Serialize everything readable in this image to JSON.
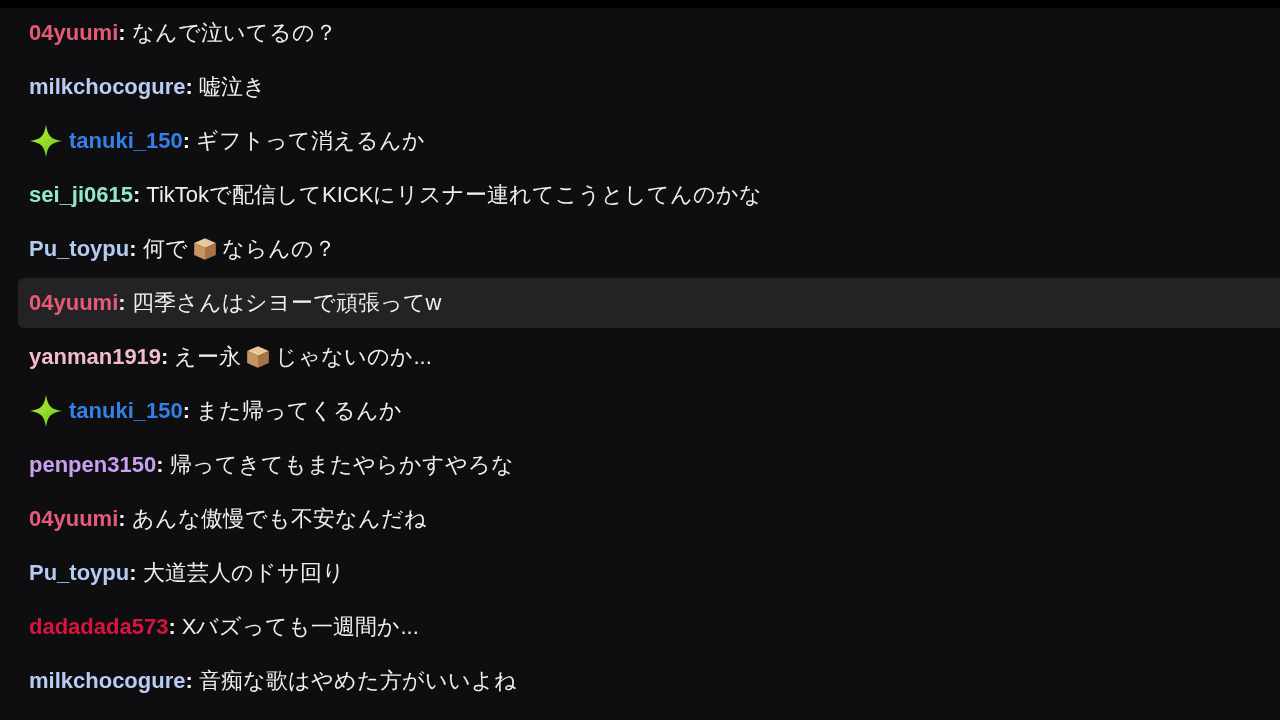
{
  "messages": [
    {
      "user": "04yuumi",
      "separator": ":",
      "color": "#e65a78",
      "badge": false,
      "selected": false,
      "parts": [
        {
          "kind": "text",
          "text": "なんで泣いてるの？"
        }
      ]
    },
    {
      "user": "milkchocogure",
      "separator": ":",
      "color": "#b8cdf2",
      "badge": false,
      "selected": false,
      "parts": [
        {
          "kind": "text",
          "text": "嘘泣き"
        }
      ]
    },
    {
      "user": "tanuki_150",
      "separator": ":",
      "color": "#3480e6",
      "badge": true,
      "selected": false,
      "parts": [
        {
          "kind": "text",
          "text": "ギフトって消えるんか"
        }
      ]
    },
    {
      "user": "sei_ji0615",
      "separator": ":",
      "color": "#93e8cc",
      "badge": false,
      "selected": false,
      "parts": [
        {
          "kind": "text",
          "text": "TikTokで配信してKICKにリスナー連れてこうとしてんのかな"
        }
      ]
    },
    {
      "user": "Pu_toypu",
      "separator": ":",
      "color": "#b4cbf2",
      "badge": false,
      "selected": false,
      "parts": [
        {
          "kind": "text",
          "text": "何で"
        },
        {
          "kind": "box"
        },
        {
          "kind": "text",
          "text": "ならんの？"
        }
      ]
    },
    {
      "user": "04yuumi",
      "separator": ":",
      "color": "#e65a78",
      "badge": false,
      "selected": true,
      "parts": [
        {
          "kind": "text",
          "text": "四季さんはシヨーで頑張ってw"
        }
      ]
    },
    {
      "user": "yanman1919",
      "separator": ":",
      "color": "#f2bccb",
      "badge": false,
      "selected": false,
      "parts": [
        {
          "kind": "text",
          "text": "えー永"
        },
        {
          "kind": "box"
        },
        {
          "kind": "text",
          "text": "じゃないのか..."
        }
      ]
    },
    {
      "user": "tanuki_150",
      "separator": ":",
      "color": "#3480e6",
      "badge": true,
      "selected": false,
      "parts": [
        {
          "kind": "text",
          "text": "また帰ってくるんか"
        }
      ]
    },
    {
      "user": "penpen3150",
      "separator": ":",
      "color": "#cc9ef2",
      "badge": false,
      "selected": false,
      "parts": [
        {
          "kind": "text",
          "text": "帰ってきてもまたやらかすやろな"
        }
      ]
    },
    {
      "user": "04yuumi",
      "separator": ":",
      "color": "#e65a78",
      "badge": false,
      "selected": false,
      "parts": [
        {
          "kind": "text",
          "text": "あんな傲慢でも不安なんだね"
        }
      ]
    },
    {
      "user": "Pu_toypu",
      "separator": ":",
      "color": "#b4cbf2",
      "badge": false,
      "selected": false,
      "parts": [
        {
          "kind": "text",
          "text": "大道芸人のドサ回り"
        }
      ]
    },
    {
      "user": "dadadada573",
      "separator": ":",
      "color": "#d8143e",
      "badge": false,
      "selected": false,
      "parts": [
        {
          "kind": "text",
          "text": "Xバズっても一週間か..."
        }
      ]
    },
    {
      "user": "milkchocogure",
      "separator": ":",
      "color": "#b8cdf2",
      "badge": false,
      "selected": false,
      "parts": [
        {
          "kind": "text",
          "text": "音痴な歌はやめた方がいいよね"
        }
      ]
    }
  ]
}
